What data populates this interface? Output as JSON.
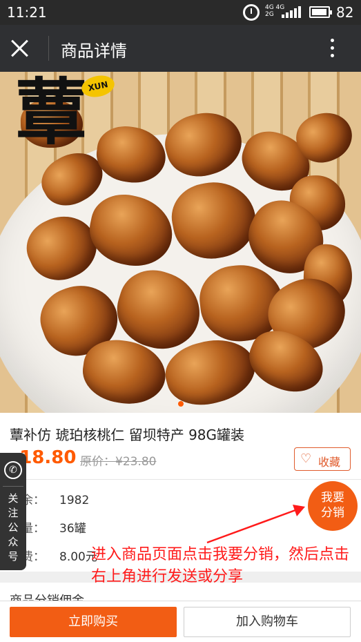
{
  "status_bar": {
    "time": "11:21",
    "network_top": "4G 4G",
    "network_bottom": "2G",
    "battery": "82"
  },
  "title_bar": {
    "title": "商品详情"
  },
  "hero": {
    "brand_char": "蕈",
    "brand_tag": "XUN",
    "slide_count": 1,
    "active_slide": 1
  },
  "product": {
    "name": "蕈补仿 琥珀核桃仁 留坝特产 98G罐装",
    "currency": "¥",
    "price": "18.80",
    "original_price": "原价：¥23.80",
    "favorite_label": "收藏",
    "details": [
      {
        "label": "剩余：",
        "value": "1982"
      },
      {
        "label": "销量：",
        "value": "36罐"
      },
      {
        "label": "运费：",
        "value": "8.00元"
      }
    ]
  },
  "section": {
    "title": "商品分销佣金"
  },
  "actions": {
    "buy_now": "立即购买",
    "add_to_cart": "加入购物车"
  },
  "follow_tab": {
    "label": "关注公众号"
  },
  "distribute_button": {
    "line1": "我要",
    "line2": "分销"
  },
  "annotation": {
    "text": "进入商品页面点击我要分销，然后点击右上角进行发送或分享",
    "color": "#ff1a1a"
  },
  "colors": {
    "accent": "#f25d14",
    "price": "#ff5a00",
    "title_bar": "#2f3033"
  }
}
